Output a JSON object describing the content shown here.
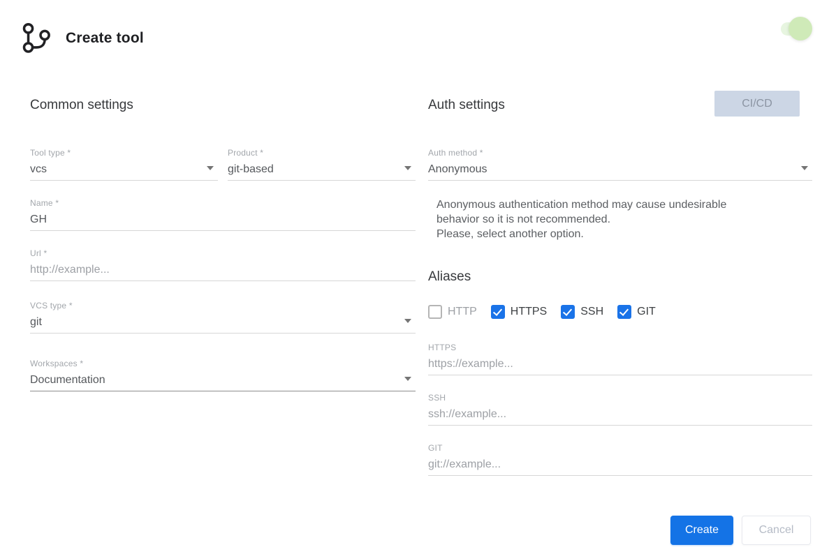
{
  "header": {
    "title": "Create tool",
    "toggle_on": true
  },
  "common": {
    "heading": "Common settings",
    "tool_type": {
      "label": "Tool type *",
      "value": "vcs"
    },
    "product": {
      "label": "Product *",
      "value": "git-based"
    },
    "name": {
      "label": "Name *",
      "value": "GH"
    },
    "url": {
      "label": "Url *",
      "placeholder": "http://example..."
    },
    "vcs_type": {
      "label": "VCS type *",
      "value": "git"
    },
    "workspaces": {
      "label": "Workspaces *",
      "value": "Documentation"
    }
  },
  "auth": {
    "heading": "Auth settings",
    "cicd_label": "CI/CD",
    "auth_method": {
      "label": "Auth method *",
      "value": "Anonymous"
    },
    "warning_line1": "Anonymous authentication method may cause undesirable behavior so it is not recommended.",
    "warning_line2": "Please, select another option."
  },
  "aliases": {
    "heading": "Aliases",
    "checkboxes": [
      {
        "label": "HTTP",
        "checked": false
      },
      {
        "label": "HTTPS",
        "checked": true
      },
      {
        "label": "SSH",
        "checked": true
      },
      {
        "label": "GIT",
        "checked": true
      }
    ],
    "https": {
      "label": "HTTPS",
      "placeholder": "https://example..."
    },
    "ssh": {
      "label": "SSH",
      "placeholder": "ssh://example..."
    },
    "git": {
      "label": "GIT",
      "placeholder": "git://example..."
    }
  },
  "footer": {
    "create_label": "Create",
    "cancel_label": "Cancel"
  },
  "colors": {
    "accent_blue": "#1473e6",
    "checkbox_blue": "#1a73e8",
    "toggle_green": "#cfeab8",
    "cicd_bg": "#ccd6e5"
  }
}
